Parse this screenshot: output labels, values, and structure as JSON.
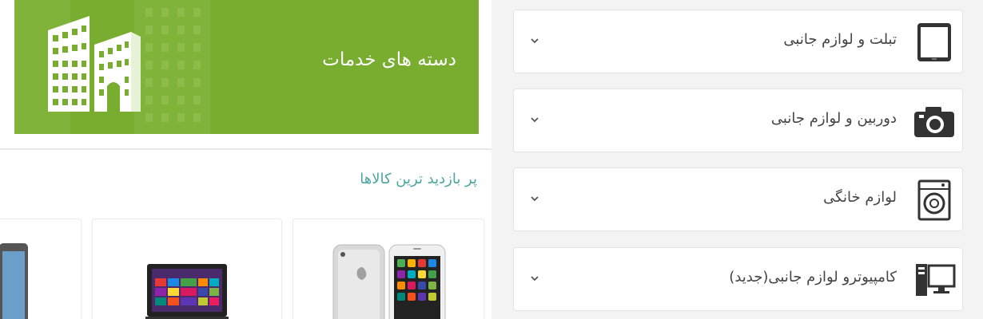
{
  "banner": {
    "title": "دسته های خدمات",
    "icon": "building-icon"
  },
  "products_section": {
    "title": "پر بازدید ترین کالاها"
  },
  "products": [
    {
      "image": "iphone-image"
    },
    {
      "image": "laptop-image"
    },
    {
      "image": "tablet-image"
    }
  ],
  "categories": [
    {
      "label": "تبلت و لوازم جانبی",
      "icon": "tablet-icon"
    },
    {
      "label": "دوربین و لوازم جانبی",
      "icon": "camera-icon"
    },
    {
      "label": "لوازم خانگی",
      "icon": "washing-machine-icon"
    },
    {
      "label": "کامپیوترو لوازم جانبی(جدید)",
      "icon": "computer-icon"
    }
  ],
  "colors": {
    "banner_green": "#78ad2f",
    "section_title": "#4aa6a0"
  }
}
